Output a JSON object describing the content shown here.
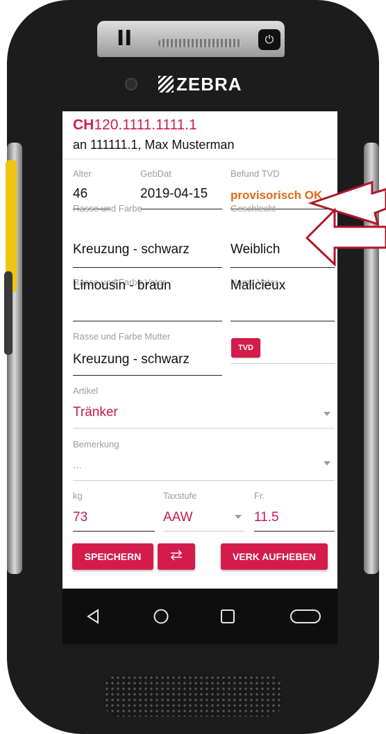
{
  "device": {
    "brand": "ZEBRA",
    "top_symbol": "II",
    "power_symbol": "⏻"
  },
  "header": {
    "id_prefix": "CH",
    "id_number": "120.1111.1111.1",
    "subtitle": "an 111111.1, Max Musterman"
  },
  "fields": {
    "alter": {
      "label": "Alter",
      "value": "46"
    },
    "gebdat": {
      "label": "GebDat",
      "value": "2019-04-15"
    },
    "befund": {
      "label": "Befund TVD",
      "value": "provisorisch OK"
    },
    "rasse": {
      "label": "Rasse und Farbe",
      "value": "Kreuzung - schwarz"
    },
    "geschlecht": {
      "label": "Geschlecht",
      "value": "Weiblich"
    },
    "rasse_vater": {
      "label": "Rasse und Farbe Vater",
      "value": "Limousin - braun"
    },
    "name_vater": {
      "label": "Name Vater",
      "value": "Malicieux"
    },
    "rasse_mutter": {
      "label": "Rasse und Farbe Mutter",
      "value": "Kreuzung - schwarz"
    },
    "tvd_button": "TVD",
    "artikel": {
      "label": "Artikel",
      "value": "Tränker"
    },
    "bemerkung": {
      "label": "Bemerkung",
      "placeholder": "..."
    },
    "kg": {
      "label": "kg",
      "value": "73"
    },
    "taxstufe": {
      "label": "Taxstufe",
      "value": "AAW"
    },
    "fr": {
      "label": "Fr.",
      "value": "11.5"
    }
  },
  "buttons": {
    "save": "SPEICHERN",
    "swap_icon": "swap-arrows-icon",
    "cancel_sale": "VERK AUFHEBEN"
  },
  "navbar": {
    "back_icon": "back-triangle-icon",
    "home_icon": "home-circle-icon",
    "recents_icon": "recents-square-icon",
    "extra_icon": "pill-button-icon"
  },
  "colors": {
    "accent": "#d31c4c",
    "id_color": "#cc1f4f",
    "status_orange": "#e16a17",
    "arrow_red": "#b11629"
  }
}
